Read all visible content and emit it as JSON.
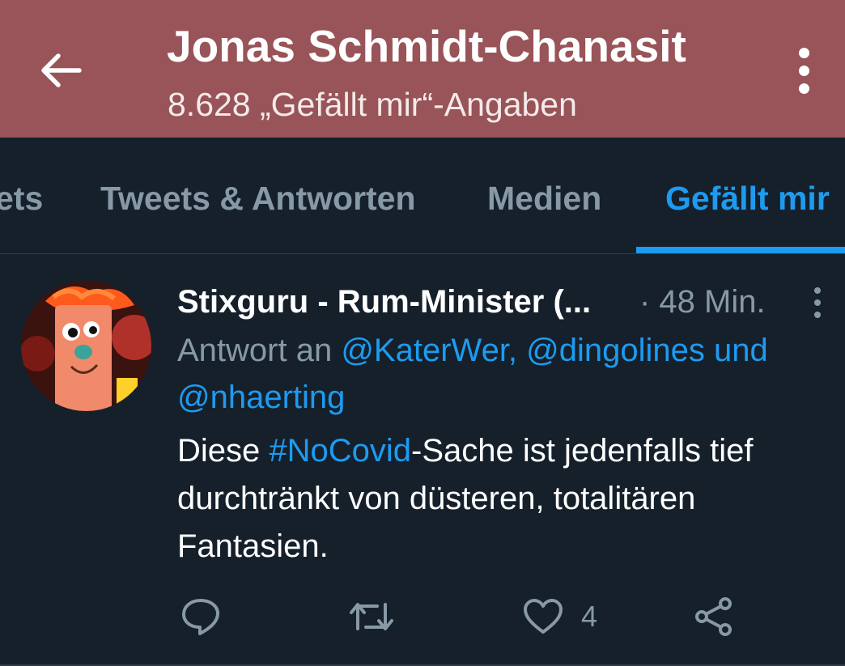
{
  "header": {
    "title": "Jonas Schmidt-Chanasit",
    "subtitle": "8.628 „Gefällt mir“-Angaben",
    "back_icon": "arrow-left-icon",
    "more_icon": "more-vertical-icon",
    "background_color": "#985458"
  },
  "tabs": [
    {
      "label": "ets",
      "active": false
    },
    {
      "label": "Tweets & Antworten",
      "active": false
    },
    {
      "label": "Medien",
      "active": false
    },
    {
      "label": "Gefällt mir",
      "active": true
    }
  ],
  "tweet": {
    "author": "Stixguru - Rum-Minister (...",
    "time": "· 48 Min.",
    "reply_prefix": "Antwort an ",
    "reply_mentions": "@KaterWer, @dingolines und @nhaerting",
    "text_before": "Diese ",
    "hashtag": "#NoCovid",
    "text_after": "-Sache ist jedenfalls tief durchtränkt von düsteren, totalitären Fantasien.",
    "like_count": "4",
    "icons": [
      "reply-icon",
      "retweet-icon",
      "like-icon",
      "share-icon"
    ]
  },
  "colors": {
    "background": "#15202b",
    "accent": "#1d9bf0",
    "muted": "#8899a6"
  }
}
